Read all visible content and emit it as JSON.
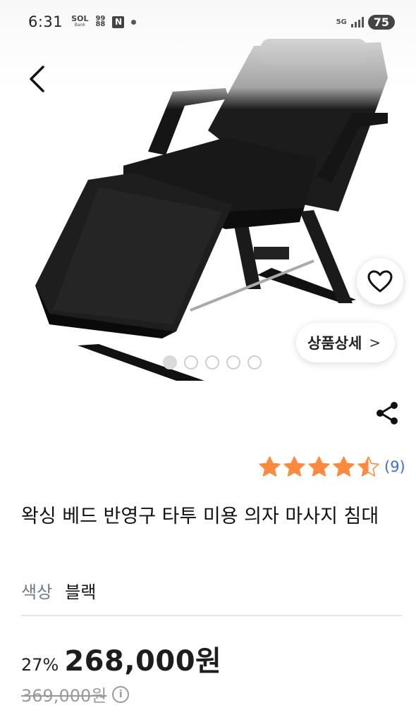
{
  "status_bar": {
    "time": "6:31",
    "sol_label": "SOL",
    "sol_sub": "Bank",
    "grid_label": "99 88",
    "notif_label": "N",
    "network_label": "5G",
    "battery": "75"
  },
  "product": {
    "image_icon": "product-photo-waxing-bed",
    "carousel": {
      "total": 5,
      "active_index": 0
    },
    "detail_button_label": "상품상세",
    "detail_button_chevron": ">",
    "rating": {
      "value": 4.5,
      "max": 5,
      "review_count": "(9)"
    },
    "title": "왁싱 베드 반영구 타투 미용 의자 마사지 침대",
    "option": {
      "label": "색상",
      "value": "블랙"
    },
    "discount": "27%",
    "price": "268,000원",
    "original_price": "369,000원",
    "info_icon_glyph": "i"
  },
  "colors": {
    "star": "#ff8a3d",
    "review_link": "#3b6fd8",
    "option_label": "#707b88"
  }
}
